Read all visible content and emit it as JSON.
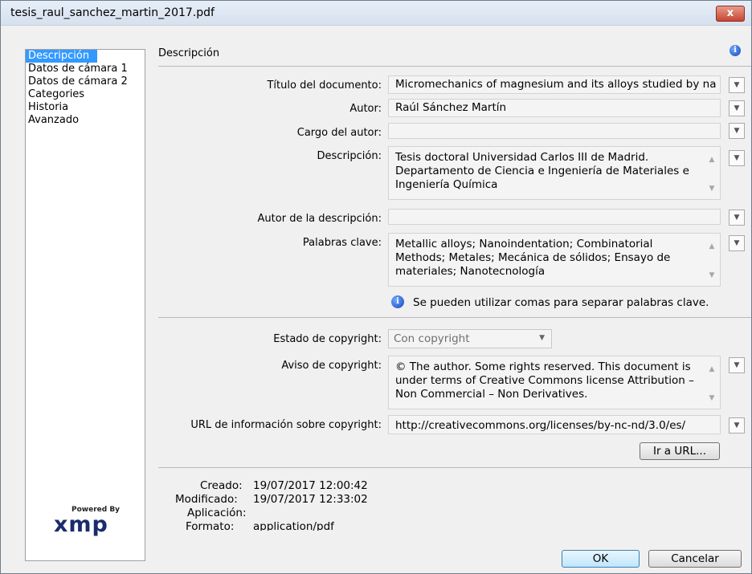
{
  "window": {
    "title": "tesis_raul_sanchez_martin_2017.pdf",
    "close_label": "x"
  },
  "sidebar": {
    "items": [
      {
        "label": "Descripción",
        "selected": true
      },
      {
        "label": "Datos de cámara 1"
      },
      {
        "label": "Datos de cámara 2"
      },
      {
        "label": "Categories"
      },
      {
        "label": "Historia"
      },
      {
        "label": "Avanzado"
      }
    ]
  },
  "section": {
    "title": "Descripción"
  },
  "fields": {
    "doc_title": {
      "label": "Título del documento:",
      "value": "Micromechanics of magnesium and its alloys studied by na"
    },
    "author": {
      "label": "Autor:",
      "value": "Raúl Sánchez Martín"
    },
    "author_title": {
      "label": "Cargo del autor:",
      "value": ""
    },
    "description": {
      "label": "Descripción:",
      "value": "Tesis doctoral Universidad Carlos III de Madrid. Departamento de Ciencia e Ingeniería de Materiales e Ingeniería Química"
    },
    "description_writer": {
      "label": "Autor de la descripción:",
      "value": ""
    },
    "keywords": {
      "label": "Palabras clave:",
      "value": "Metallic alloys; Nanoindentation; Combinatorial Methods; Metales; Mecánica de sólidos; Ensayo de materiales; Nanotecnología"
    },
    "keywords_hint": "Se pueden utilizar comas para separar palabras clave.",
    "copyright_status": {
      "label": "Estado de copyright:",
      "value": "Con copyright"
    },
    "copyright_notice": {
      "label": "Aviso de copyright:",
      "value": "© The author. Some rights reserved. This document is under terms of Creative Commons license Attribution – Non Commercial – Non Derivatives."
    },
    "copyright_url": {
      "label": "URL de información sobre copyright:",
      "value": "http://creativecommons.org/licenses/by-nc-nd/3.0/es/"
    }
  },
  "go_url_button": "Ir a URL...",
  "metadata": {
    "created_label": "Creado:",
    "created_value": "19/07/2017 12:00:42",
    "modified_label": "Modificado:",
    "modified_value": "19/07/2017 12:33:02",
    "application_label": "Aplicación:",
    "application_value": "",
    "format_label": "Formato:",
    "format_value": "application/pdf"
  },
  "logo": {
    "powered_by": "Powered By",
    "name": "xmp"
  },
  "buttons": {
    "ok": "OK",
    "cancel": "Cancelar"
  },
  "colors": {
    "selection": "#3399ff",
    "close_button": "#c74631",
    "info_icon": "#1447b8"
  }
}
